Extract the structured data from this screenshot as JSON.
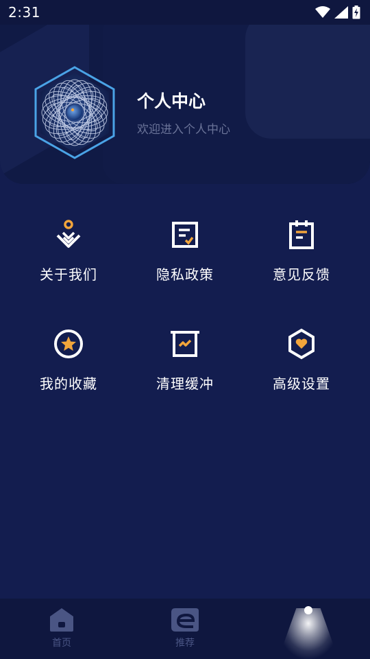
{
  "status_bar": {
    "time": "2:31"
  },
  "profile": {
    "title": "个人中心",
    "subtitle": "欢迎进入个人中心"
  },
  "menu": [
    {
      "label": "关于我们",
      "icon": "about-icon"
    },
    {
      "label": "隐私政策",
      "icon": "privacy-policy-icon"
    },
    {
      "label": "意见反馈",
      "icon": "feedback-icon"
    },
    {
      "label": "我的收藏",
      "icon": "favorites-star-icon"
    },
    {
      "label": "清理缓冲",
      "icon": "clear-cache-icon"
    },
    {
      "label": "高级设置",
      "icon": "advanced-settings-icon"
    }
  ],
  "bottom_nav": [
    {
      "label": "首页",
      "icon": "home-icon"
    },
    {
      "label": "推荐",
      "icon": "recommend-icon"
    },
    {
      "label": "",
      "icon": "profile-icon",
      "active": true
    }
  ],
  "colors": {
    "background": "#131d4f",
    "header": "#101a45",
    "accent_orange": "#f2a53b",
    "nav_inactive": "#4a5584"
  }
}
